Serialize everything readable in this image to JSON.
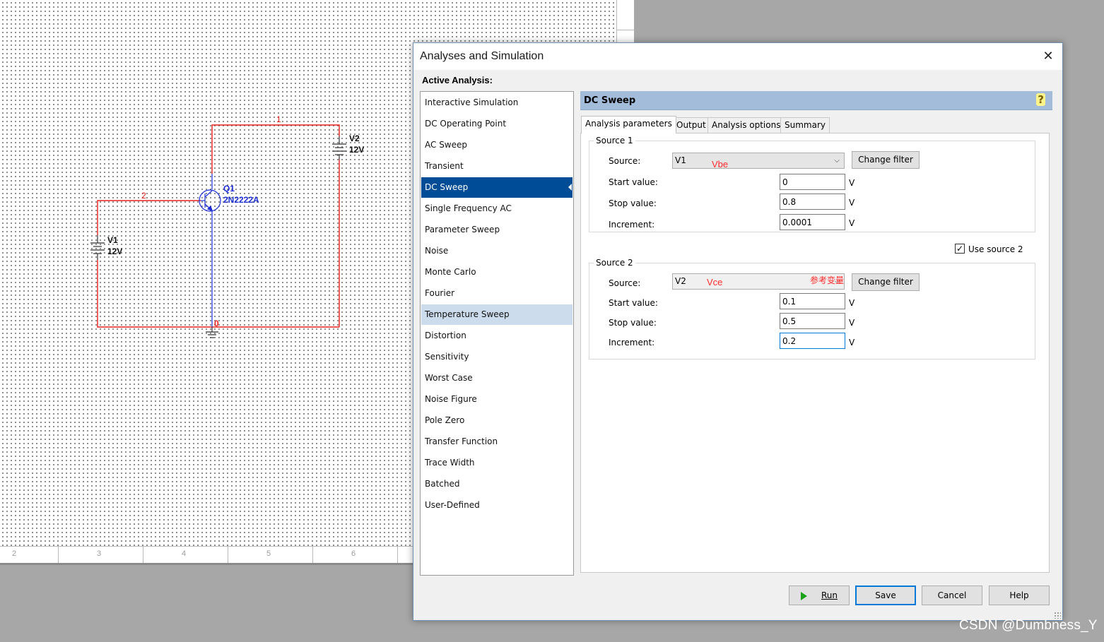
{
  "schematic": {
    "net_labels": [
      "1",
      "2",
      "0"
    ],
    "components": {
      "q1": {
        "ref": "Q1",
        "model": "2N2222A"
      },
      "v1": {
        "ref": "V1",
        "value": "12V"
      },
      "v2": {
        "ref": "V2",
        "value": "12V"
      }
    },
    "ruler_numbers": [
      "2",
      "3",
      "4",
      "5",
      "6"
    ],
    "colors": {
      "wire": "#e8201c",
      "component": "#1c2fd6",
      "net_label": "#e8201c"
    }
  },
  "dialog": {
    "title": "Analyses and Simulation",
    "close_symbol": "✕",
    "active_analysis_label": "Active Analysis:",
    "analyses": [
      {
        "label": "Interactive Simulation",
        "state": "normal"
      },
      {
        "label": "DC Operating Point",
        "state": "normal"
      },
      {
        "label": "AC Sweep",
        "state": "normal"
      },
      {
        "label": "Transient",
        "state": "normal"
      },
      {
        "label": "DC Sweep",
        "state": "selected"
      },
      {
        "label": "Single Frequency AC",
        "state": "normal"
      },
      {
        "label": "Parameter Sweep",
        "state": "normal"
      },
      {
        "label": "Noise",
        "state": "normal"
      },
      {
        "label": "Monte Carlo",
        "state": "normal"
      },
      {
        "label": "Fourier",
        "state": "normal"
      },
      {
        "label": "Temperature Sweep",
        "state": "hover"
      },
      {
        "label": "Distortion",
        "state": "normal"
      },
      {
        "label": "Sensitivity",
        "state": "normal"
      },
      {
        "label": "Worst Case",
        "state": "normal"
      },
      {
        "label": "Noise Figure",
        "state": "normal"
      },
      {
        "label": "Pole Zero",
        "state": "normal"
      },
      {
        "label": "Transfer Function",
        "state": "normal"
      },
      {
        "label": "Trace Width",
        "state": "normal"
      },
      {
        "label": "Batched",
        "state": "normal"
      },
      {
        "label": "User-Defined",
        "state": "normal"
      }
    ],
    "panel_title": "DC Sweep",
    "help_symbol": "?",
    "tabs": [
      "Analysis parameters",
      "Output",
      "Analysis options",
      "Summary"
    ],
    "active_tab": "Analysis parameters",
    "source1": {
      "group_title": "Source 1",
      "source_label": "Source:",
      "source_value": "V1",
      "annotation": "Vbe",
      "change_filter": "Change filter",
      "start_label": "Start value:",
      "start_value": "0",
      "stop_label": "Stop value:",
      "stop_value": "0.8",
      "increment_label": "Increment:",
      "increment_value": "0.0001",
      "unit": "V"
    },
    "use_source2": {
      "label": "Use source 2",
      "checked": true,
      "check_symbol": "✓"
    },
    "source2": {
      "group_title": "Source 2",
      "source_label": "Source:",
      "source_value": "V2",
      "annotation": "Vce",
      "annotation_note": "参考变量",
      "change_filter": "Change filter",
      "start_label": "Start value:",
      "start_value": "0.1",
      "stop_label": "Stop value:",
      "stop_value": "0.5",
      "increment_label": "Increment:",
      "increment_value": "0.2",
      "unit": "V"
    },
    "buttons": {
      "run": "Run",
      "save": "Save",
      "cancel": "Cancel",
      "help": "Help"
    },
    "colors": {
      "header": "#a2bcd9",
      "selected": "#004c97",
      "hover": "#ccdcec",
      "focus": "#0078d7",
      "annotation": "#ff2a2a"
    }
  },
  "watermark": "CSDN @Dumbness_Y"
}
